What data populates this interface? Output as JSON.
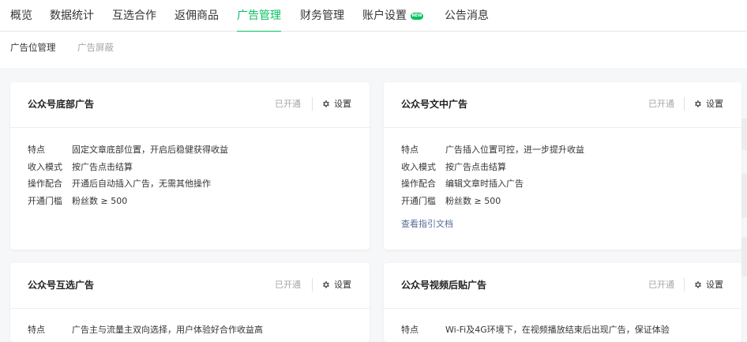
{
  "nav": {
    "tabs": [
      "概览",
      "数据统计",
      "互选合作",
      "返佣商品",
      "广告管理",
      "财务管理",
      "账户设置",
      "公告消息"
    ],
    "active_tab": "广告管理",
    "new_badge": "NEW"
  },
  "subnav": {
    "items": [
      "广告位管理",
      "广告屏蔽"
    ],
    "active": "广告位管理"
  },
  "colors": {
    "accent": "#07c160",
    "link": "#576b95",
    "muted": "#a5a5a5"
  },
  "cards": [
    {
      "title": "公众号底部广告",
      "status": "已开通",
      "settings": "设置",
      "rows": [
        {
          "label": "特点",
          "value": "固定文章底部位置，开启后稳健获得收益"
        },
        {
          "label": "收入模式",
          "value": "按广告点击结算"
        },
        {
          "label": "操作配合",
          "value": "开通后自动插入广告，无需其他操作"
        },
        {
          "label": "开通门槛",
          "value": "粉丝数 ≥ 500"
        }
      ]
    },
    {
      "title": "公众号文中广告",
      "status": "已开通",
      "settings": "设置",
      "rows": [
        {
          "label": "特点",
          "value": "广告插入位置可控，进一步提升收益"
        },
        {
          "label": "收入模式",
          "value": "按广告点击结算"
        },
        {
          "label": "操作配合",
          "value": "编辑文章时插入广告"
        },
        {
          "label": "开通门槛",
          "value": "粉丝数 ≥ 500"
        }
      ],
      "link": "查看指引文档"
    },
    {
      "title": "公众号互选广告",
      "status": "已开通",
      "settings": "设置",
      "rows": [
        {
          "label": "特点",
          "value": "广告主与流量主双向选择，用户体验好合作收益高"
        }
      ]
    },
    {
      "title": "公众号视频后贴广告",
      "status": "已开通",
      "settings": "设置",
      "rows": [
        {
          "label": "特点",
          "value": "Wi-Fi及4G环境下，在视频播放结束后出现广告，保证体验"
        }
      ]
    }
  ]
}
